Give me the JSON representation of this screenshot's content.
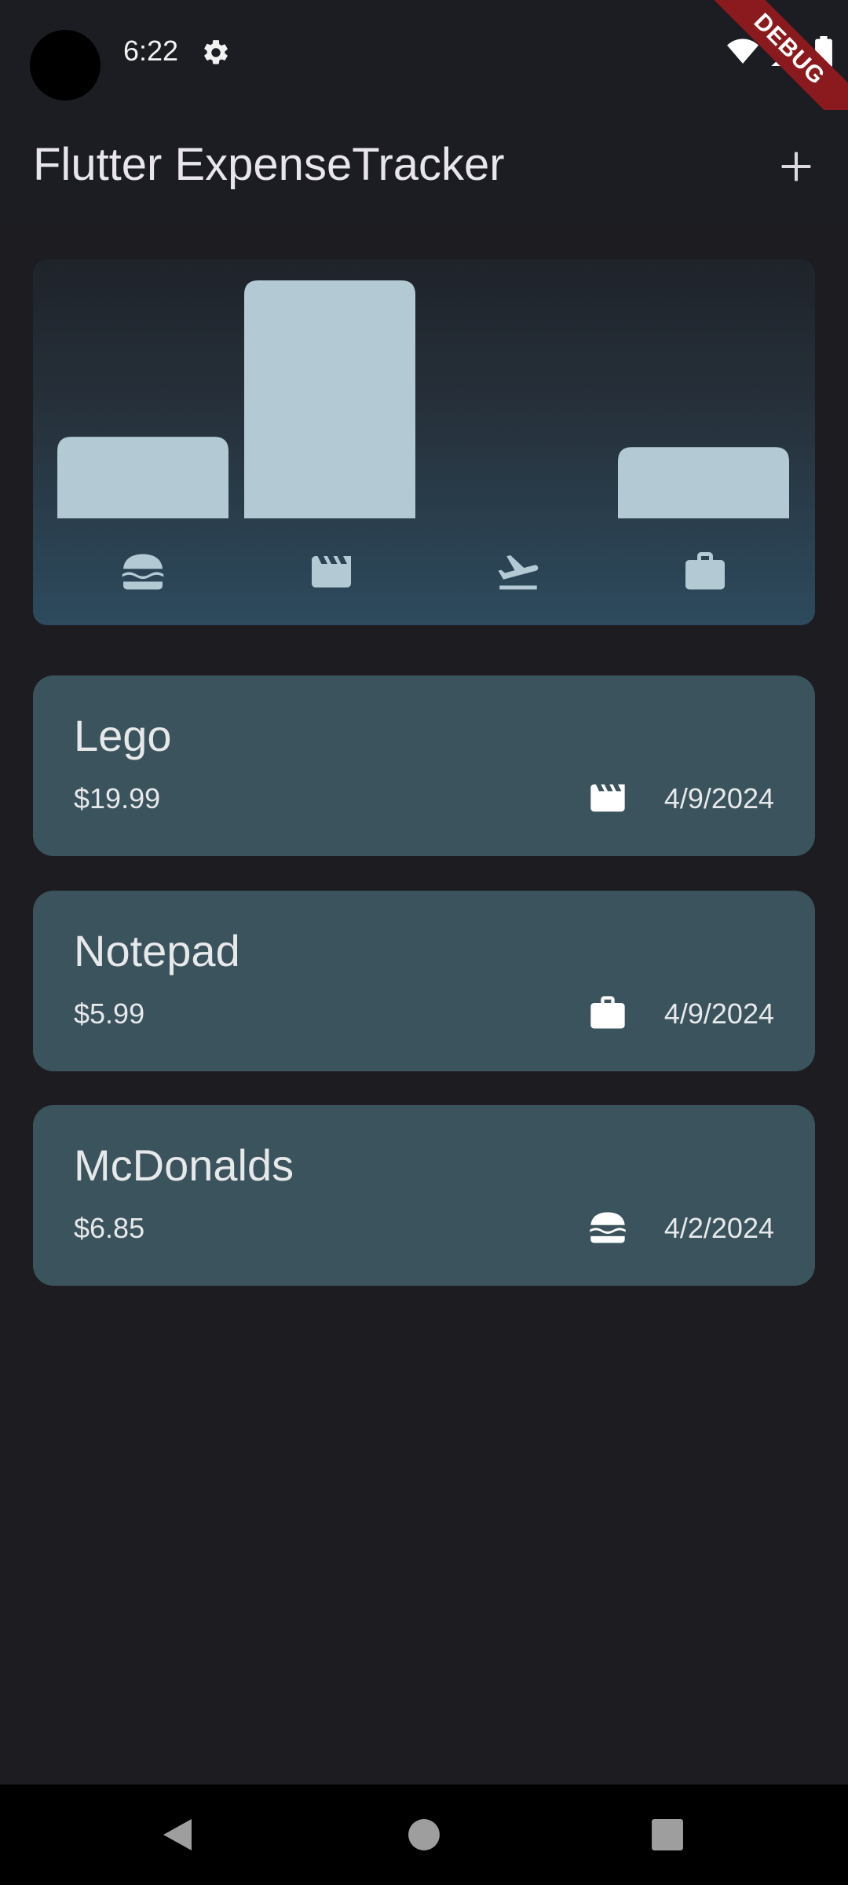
{
  "status_bar": {
    "time": "6:22",
    "debug_label": "DEBUG"
  },
  "app_bar": {
    "title": "Flutter ExpenseTracker"
  },
  "chart_data": {
    "type": "bar",
    "categories": [
      "food",
      "leisure",
      "travel",
      "work"
    ],
    "category_icons": [
      "hamburger-icon",
      "clapperboard-icon",
      "airplane-departure-icon",
      "briefcase-icon"
    ],
    "values": [
      6.85,
      19.99,
      0,
      5.99
    ],
    "bar_color": "#b3c9d4",
    "title": "",
    "xlabel": "",
    "ylabel": ""
  },
  "expenses": [
    {
      "title": "Lego",
      "amount": "$19.99",
      "category_icon": "clapperboard-icon",
      "date": "4/9/2024"
    },
    {
      "title": "Notepad",
      "amount": "$5.99",
      "category_icon": "briefcase-icon",
      "date": "4/9/2024"
    },
    {
      "title": "McDonalds",
      "amount": "$6.85",
      "category_icon": "hamburger-icon",
      "date": "4/2/2024"
    }
  ],
  "colors": {
    "background": "#1d1c21",
    "card": "#3b535c",
    "debug_ribbon": "#8a1a1e"
  }
}
